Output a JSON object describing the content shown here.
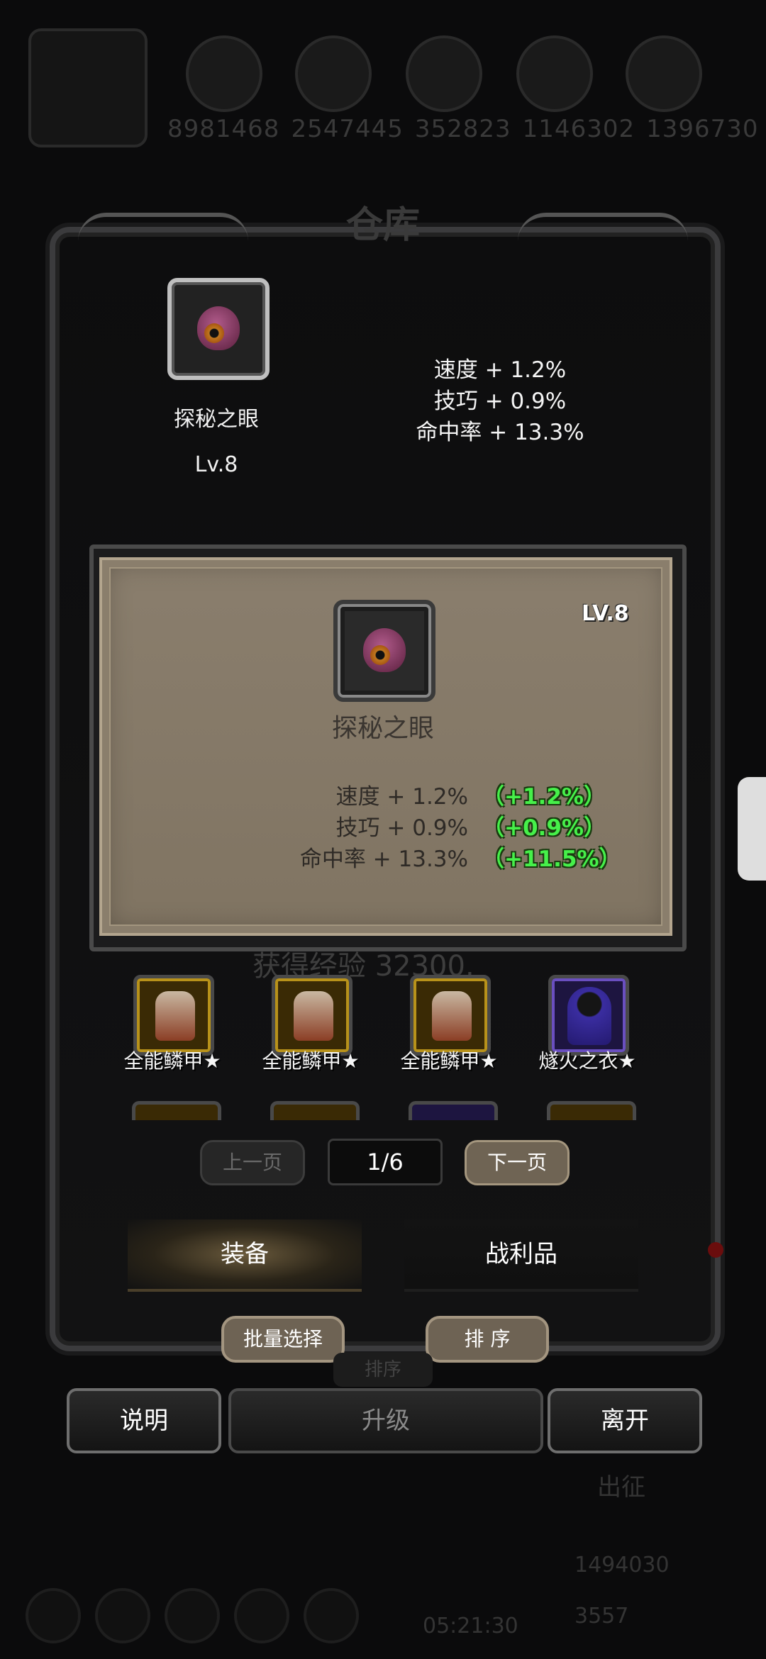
{
  "resources": {
    "values": [
      "8981468",
      "2547445",
      "352823",
      "1146302",
      "1396730"
    ]
  },
  "window_title": "仓库",
  "equipped_item": {
    "name": "探秘之眼",
    "level": "Lv.8",
    "stats": [
      "速度 + 1.2%",
      "技巧 + 0.9%",
      "命中率 + 13.3%"
    ]
  },
  "item_popup": {
    "level": "LV.8",
    "name": "探秘之眼",
    "stats": [
      "速度 + 1.2%",
      "技巧 + 0.9%",
      "命中率 + 13.3%"
    ],
    "bonuses": [
      "（+1.2%）",
      "（+0.9%）",
      "（+11.5%）"
    ]
  },
  "background_text": {
    "exp": "获得经验 32300.",
    "sort": "排序",
    "depart": "出征",
    "gold": "1494030",
    "gem": "3557",
    "timer": "05:21:30"
  },
  "inventory": {
    "items": [
      {
        "label": "全能鳞甲★",
        "type": "armor"
      },
      {
        "label": "全能鳞甲★",
        "type": "armor"
      },
      {
        "label": "全能鳞甲★",
        "type": "armor"
      },
      {
        "label": "燧火之衣★",
        "type": "cloak"
      }
    ]
  },
  "pagination": {
    "prev_label": "上一页",
    "page": "1/6",
    "next_label": "下一页"
  },
  "tabs": {
    "equipment": "装备",
    "loot": "战利品"
  },
  "actions": {
    "batch_select": "批量选择",
    "sort": "排 序",
    "help": "说明",
    "upgrade": "升级",
    "leave": "离开"
  },
  "colors": {
    "bonus_green": "#46f04a",
    "parchment": "#8a7e6d"
  }
}
